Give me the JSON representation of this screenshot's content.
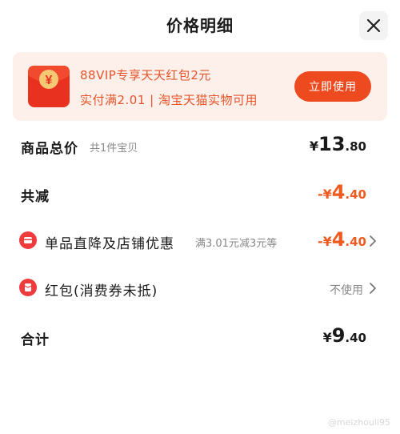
{
  "header": {
    "title": "价格明细",
    "close_icon": "close-icon"
  },
  "promo": {
    "line1": "88VIP专享天天红包2元",
    "line2": "实付满2.01 | 淘宝天猫实物可用",
    "button_label": "立即使用",
    "icon": "red-envelope-yen-icon",
    "icon_symbol": "¥",
    "accent_color": "#ee4a1f"
  },
  "rows": {
    "subtotal": {
      "label": "商品总价",
      "sub": "共1件宝贝",
      "currency": "¥",
      "integer": "13",
      "decimal": ".80"
    },
    "total_discount": {
      "label": "共减",
      "prefix": "-¥",
      "integer": "4",
      "decimal": ".40"
    },
    "store_discount": {
      "label": "单品直降及店铺优惠",
      "sub": "满3.01元减3元等",
      "prefix": "-¥",
      "integer": "4",
      "decimal": ".40",
      "icon": "discount-icon"
    },
    "red_packet": {
      "label": "红包(消费券未抵)",
      "status": "不使用",
      "icon": "red-packet-icon"
    },
    "total": {
      "label": "合计",
      "currency": "¥",
      "integer": "9",
      "decimal": ".40"
    }
  },
  "watermark": "@meizhouli95"
}
